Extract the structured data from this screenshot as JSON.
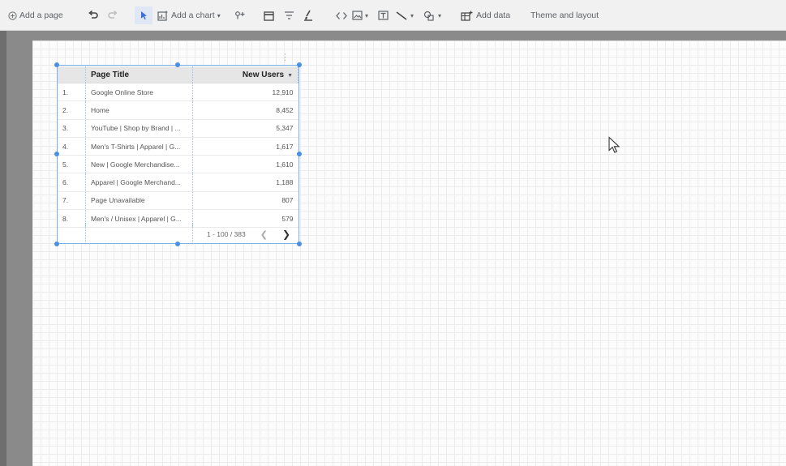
{
  "toolbar": {
    "add_page_label": "Add a page",
    "add_chart_label": "Add a chart",
    "add_data_label": "Add data",
    "theme_layout_label": "Theme and layout"
  },
  "table": {
    "headers": {
      "title": "Page Title",
      "metric": "New Users"
    },
    "rows": [
      {
        "idx": "1.",
        "title": "Google Online Store",
        "value": "12,910"
      },
      {
        "idx": "2.",
        "title": "Home",
        "value": "8,452"
      },
      {
        "idx": "3.",
        "title": "YouTube | Shop by Brand | ...",
        "value": "5,347"
      },
      {
        "idx": "4.",
        "title": "Men's T-Shirts | Apparel | G...",
        "value": "1,617"
      },
      {
        "idx": "5.",
        "title": "New | Google Merchandise...",
        "value": "1,610"
      },
      {
        "idx": "6.",
        "title": "Apparel | Google Merchand...",
        "value": "1,188"
      },
      {
        "idx": "7.",
        "title": "Page Unavailable",
        "value": "807"
      },
      {
        "idx": "8.",
        "title": "Men's / Unisex | Apparel | G...",
        "value": "579"
      }
    ],
    "pagination": "1 - 100 / 383"
  },
  "colors": {
    "selection": "#4a90e2",
    "header_bg": "#e6e6e6",
    "toolbar_bg": "#f1f1f1"
  }
}
